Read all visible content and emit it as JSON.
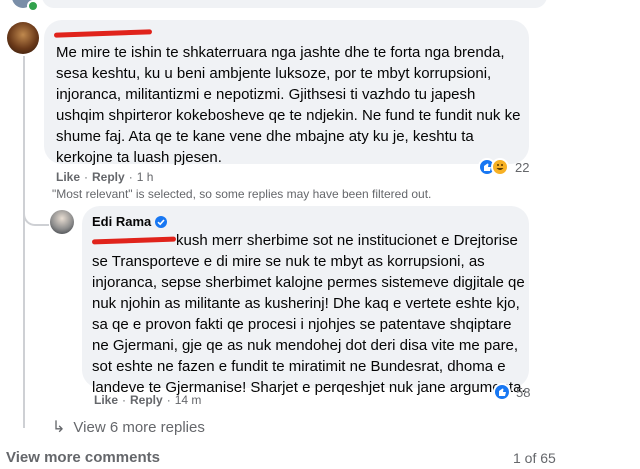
{
  "top_comment": {
    "author": "",
    "text": "Me mire te ishin te shkaterruara nga jashte dhe te forta nga brenda,\nsesa keshtu, ku u beni ambjente luksoze, por te mbyt korrupsioni,\ninjoranca, militantizmi e nepotizmi. Gjithsesi ti vazhdo tu japesh\nushqim shpirteror kokebosheve qe te ndjekin. Ne fund te fundit nuk ke\nshume faj. Ata qe te kane vene dhe mbajne aty ku je, keshtu ta\nkerkojne ta luash pjesen.",
    "like_label": "Like",
    "reply_label": "Reply",
    "time": "1 h",
    "reaction_count": "22"
  },
  "filter_notice": "\"Most relevant\" is selected, so some replies may have been filtered out.",
  "reply": {
    "author": "Edi Rama",
    "text": "kush merr sherbime sot ne institucionet e Drejtorise\nse Transporteve e di mire se nuk te mbyt as korrupsioni, as\ninjoranca, sepse sherbimet kalojne permes sistemeve digjitale qe\nnuk njohin as militante as kusherinj! Dhe kaq e vertete eshte kjo,\nsa qe e provon fakti qe procesi i njohjes se patentave shqiptare\nne Gjermani, gje qe as nuk mendohej dot deri disa vite me pare,\nsot eshte ne fazen e fundit te miratimit ne Bundesrat, dhoma e\nlandeve te Gjermanise! Sharjet e perqeshjet nuk jane argumenta.",
    "like_label": "Like",
    "reply_label": "Reply",
    "time": "14 m",
    "reaction_count": "58"
  },
  "view_more_replies": "View 6 more replies",
  "view_more_comments": "View more comments",
  "pagination": "1 of 65",
  "colors": {
    "bubble": "#f0f2f5",
    "like_blue": "#1877f2",
    "haha_yellow": "#f7b125",
    "redaction": "#e0231b",
    "verified": "#1877f2"
  }
}
